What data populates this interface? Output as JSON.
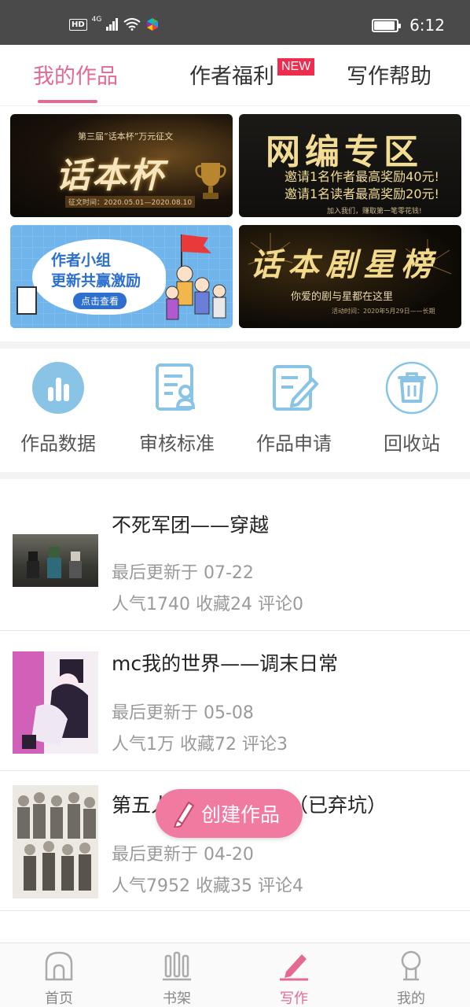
{
  "status_bar": {
    "hd": "HD",
    "network": "4G",
    "time": "6:12",
    "battery_level": 0.85
  },
  "top_tabs": [
    {
      "label": "我的作品",
      "active": true
    },
    {
      "label": "作者福利",
      "active": false,
      "badge": "NEW"
    },
    {
      "label": "写作帮助",
      "active": false
    }
  ],
  "banners": {
    "b1": {
      "subtitle": "第三届“话本杯”万元征文",
      "title": "话本杯",
      "date": "征文时间：2020.05.01—2020.08.10"
    },
    "b2": {
      "title": "网编专区",
      "line1": "邀请1名作者最高奖励40元!",
      "line2": "邀请1名读者最高奖励20元!",
      "foot": "加入我们，赚取第一笔零花钱!"
    },
    "b3": {
      "line1": "作者小组",
      "line2": "更新共赢激励",
      "button": "点击查看"
    },
    "b4": {
      "title": "话本剧星榜",
      "subtitle": "你爱的剧与星都在这里",
      "foot": "活动时间：2020年5月29日——长期"
    }
  },
  "actions": [
    {
      "label": "作品数据",
      "icon": "bar-chart-icon"
    },
    {
      "label": "审核标准",
      "icon": "review-standard-icon"
    },
    {
      "label": "作品申请",
      "icon": "edit-document-icon"
    },
    {
      "label": "回收站",
      "icon": "trash-icon"
    }
  ],
  "works": [
    {
      "title": "不死军团——穿越",
      "updated": "最后更新于 07-22",
      "stats": "人气1740 收藏24 评论0"
    },
    {
      "title": "mc我的世界——调末日常",
      "updated": "最后更新于 05-08",
      "stats": "人气1万 收藏72 评论3"
    },
    {
      "title": "第五人格之荒诞童话（已弃坑）",
      "updated": "最后更新于 04-20",
      "stats": "人气7952 收藏35 评论4"
    }
  ],
  "create_button": {
    "label": "创建作品"
  },
  "bottom_nav": [
    {
      "label": "首页",
      "icon": "home-icon",
      "active": false
    },
    {
      "label": "书架",
      "icon": "bookshelf-icon",
      "active": false
    },
    {
      "label": "写作",
      "icon": "pen-icon",
      "active": true
    },
    {
      "label": "我的",
      "icon": "profile-icon",
      "active": false
    }
  ],
  "colors": {
    "accent": "#e56a91",
    "icon_blue": "#89c3e6",
    "create_button": "#f07aa0"
  }
}
